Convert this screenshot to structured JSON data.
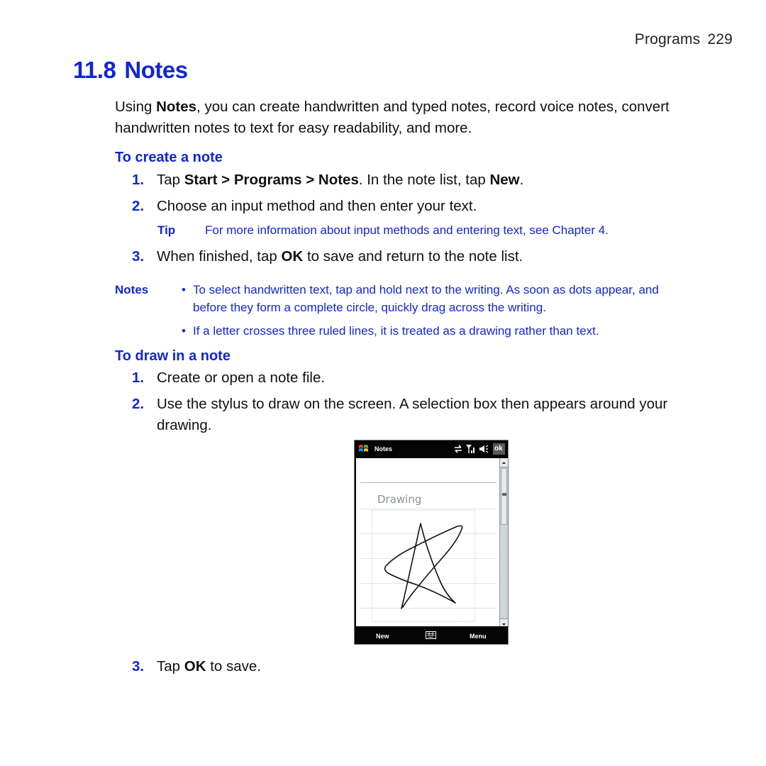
{
  "running_head": {
    "section": "Programs",
    "page": "229"
  },
  "heading": {
    "number": "11.8",
    "title": "Notes"
  },
  "intro": {
    "pre": "Using ",
    "bold": "Notes",
    "post": ", you can create handwritten and typed notes, record voice notes, convert handwritten notes to text for easy readability, and more."
  },
  "create_section": {
    "title": "To create a note",
    "steps": [
      {
        "n": "1.",
        "parts": [
          "Tap ",
          "Start > Programs > Notes",
          ". In the note list, tap ",
          "New",
          "."
        ]
      },
      {
        "n": "2.",
        "text": "Choose an input method and then enter your text."
      },
      {
        "n": "3.",
        "parts": [
          "When finished, tap ",
          "OK",
          " to save and return to the note list."
        ]
      }
    ],
    "tip": {
      "label": "Tip",
      "text": "For more information about input methods and entering text, see Chapter 4."
    }
  },
  "notes_box": {
    "label": "Notes",
    "bullet": "•",
    "items": [
      "To select handwritten text, tap and hold next to the writing. As soon as dots appear, and before they form a complete circle, quickly drag across the writing.",
      "If a letter crosses three ruled lines, it is treated as a drawing rather than text."
    ]
  },
  "draw_section": {
    "title": "To draw in a note",
    "steps": [
      {
        "n": "1.",
        "text": "Create or open a note file."
      },
      {
        "n": "2.",
        "text": "Use the stylus to draw on the screen. A selection box then appears around your drawing."
      },
      {
        "n": "3.",
        "parts": [
          "Tap ",
          "OK",
          " to save."
        ]
      }
    ]
  },
  "phone": {
    "title": "Notes",
    "ok_label": "ok",
    "drawing_label": "Drawing",
    "left_softkey": "New",
    "right_softkey": "Menu"
  },
  "colors": {
    "accent_blue": "#1126d6",
    "text": "#111111"
  }
}
